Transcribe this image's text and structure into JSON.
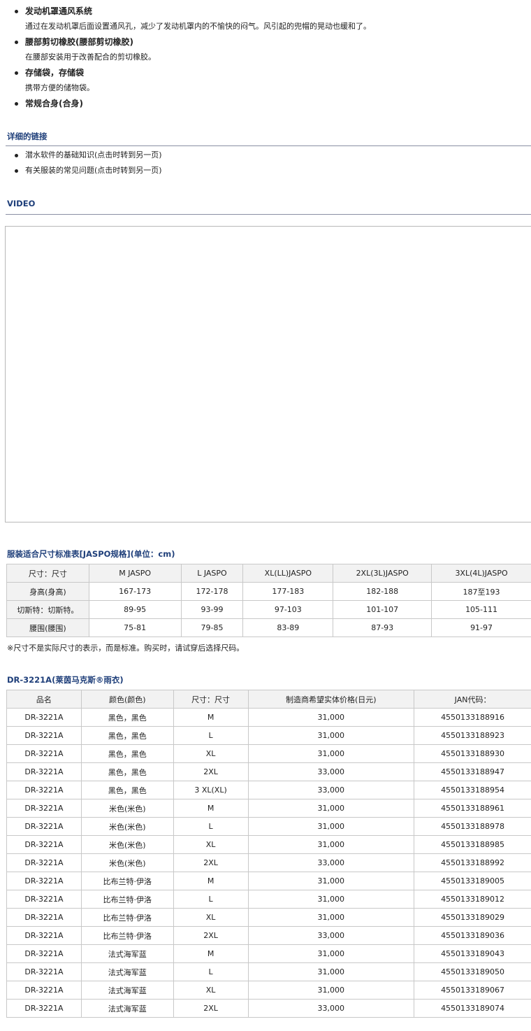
{
  "features": [
    {
      "title": "发动机罩通风系统",
      "desc": "通过在发动机罩后面设置通风孔，减少了发动机罩内的不愉快的闷气。风引起的兜帽的晃动也缓和了。"
    },
    {
      "title": "腰部剪切橡胶(腰部剪切橡胶)",
      "desc": "在腰部安装用于改善配合的剪切橡胶。"
    },
    {
      "title": "存储袋，存储袋",
      "desc": "携带方便的储物袋。"
    },
    {
      "title": "常规合身(合身)",
      "desc": ""
    }
  ],
  "links_section": {
    "heading": "详细的链接",
    "items": [
      "潜水软件的基础知识(点击时转到另一页)",
      "有关服装的常见问题(点击时转到另一页)"
    ]
  },
  "video_section": {
    "heading": "VIDEO"
  },
  "size_section": {
    "heading": "服装适合尺寸标准表[JASPO规格](单位：cm)",
    "columns": [
      "尺寸：尺寸",
      "M JASPO",
      "L JASPO",
      "XL(LL)JASPO",
      "2XL(3L)JASPO",
      "3XL(4L)JASPO"
    ],
    "rows": [
      [
        "身高(身高)",
        "167-173",
        "172-178",
        "177-183",
        "182-188",
        "187至193"
      ],
      [
        "切斯特：切斯特。",
        "89-95",
        "93-99",
        "97-103",
        "101-107",
        "105-111"
      ],
      [
        "腰围(腰围)",
        "75-81",
        "79-85",
        "83-89",
        "87-93",
        "91-97"
      ]
    ],
    "note": "※尺寸不是实际尺寸的表示，而是标准。购买时，请试穿后选择尺码。"
  },
  "product_section": {
    "heading": "DR-3221A(莱茵马克斯®雨衣)",
    "columns": [
      "品名",
      "颜色(颜色)",
      "尺寸：尺寸",
      "制造商希望实体价格(日元)",
      "JAN代码："
    ],
    "rows": [
      [
        "DR-3221A",
        "黑色，黑色",
        "M",
        "31,000",
        "4550133188916"
      ],
      [
        "DR-3221A",
        "黑色，黑色",
        "L",
        "31,000",
        "4550133188923"
      ],
      [
        "DR-3221A",
        "黑色，黑色",
        "XL",
        "31,000",
        "4550133188930"
      ],
      [
        "DR-3221A",
        "黑色，黑色",
        "2XL",
        "33,000",
        "4550133188947"
      ],
      [
        "DR-3221A",
        "黑色，黑色",
        "3 XL(XL)",
        "33,000",
        "4550133188954"
      ],
      [
        "DR-3221A",
        "米色(米色)",
        "M",
        "31,000",
        "4550133188961"
      ],
      [
        "DR-3221A",
        "米色(米色)",
        "L",
        "31,000",
        "4550133188978"
      ],
      [
        "DR-3221A",
        "米色(米色)",
        "XL",
        "31,000",
        "4550133188985"
      ],
      [
        "DR-3221A",
        "米色(米色)",
        "2XL",
        "33,000",
        "4550133188992"
      ],
      [
        "DR-3221A",
        "比布兰特·伊洛",
        "M",
        "31,000",
        "4550133189005"
      ],
      [
        "DR-3221A",
        "比布兰特·伊洛",
        "L",
        "31,000",
        "4550133189012"
      ],
      [
        "DR-3221A",
        "比布兰特·伊洛",
        "XL",
        "31,000",
        "4550133189029"
      ],
      [
        "DR-3221A",
        "比布兰特·伊洛",
        "2XL",
        "33,000",
        "4550133189036"
      ],
      [
        "DR-3221A",
        "法式海军蓝",
        "M",
        "31,000",
        "4550133189043"
      ],
      [
        "DR-3221A",
        "法式海军蓝",
        "L",
        "31,000",
        "4550133189050"
      ],
      [
        "DR-3221A",
        "法式海军蓝",
        "XL",
        "31,000",
        "4550133189067"
      ],
      [
        "DR-3221A",
        "法式海军蓝",
        "2XL",
        "33,000",
        "4550133189074"
      ]
    ]
  },
  "colors": {
    "heading": "#1f3f7a",
    "table_header_bg": "#f2f2f2",
    "border": "#c8c8c8"
  }
}
